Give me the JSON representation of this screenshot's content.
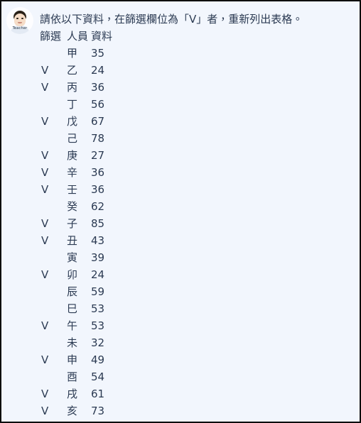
{
  "avatar": {
    "label": "Teacher",
    "icon": "user-avatar-icon"
  },
  "message": {
    "prompt": "請依以下資料，在篩選欄位為「V」者，重新列出表格。",
    "table": {
      "headers": {
        "filter": "篩選",
        "person": "人員",
        "data": "資料"
      },
      "rows": [
        {
          "filter": "",
          "person": "甲",
          "data": "35"
        },
        {
          "filter": "V",
          "person": "乙",
          "data": "24"
        },
        {
          "filter": "V",
          "person": "丙",
          "data": "36"
        },
        {
          "filter": "",
          "person": "丁",
          "data": "56"
        },
        {
          "filter": "V",
          "person": "戊",
          "data": "67"
        },
        {
          "filter": "",
          "person": "己",
          "data": "78"
        },
        {
          "filter": "V",
          "person": "庚",
          "data": "27"
        },
        {
          "filter": "V",
          "person": "辛",
          "data": "36"
        },
        {
          "filter": "V",
          "person": "壬",
          "data": "36"
        },
        {
          "filter": "",
          "person": "癸",
          "data": "62"
        },
        {
          "filter": "V",
          "person": "子",
          "data": "85"
        },
        {
          "filter": "V",
          "person": "丑",
          "data": "43"
        },
        {
          "filter": "",
          "person": "寅",
          "data": "39"
        },
        {
          "filter": "V",
          "person": "卯",
          "data": "24"
        },
        {
          "filter": "",
          "person": "辰",
          "data": "59"
        },
        {
          "filter": "",
          "person": "巳",
          "data": "53"
        },
        {
          "filter": "V",
          "person": "午",
          "data": "53"
        },
        {
          "filter": "",
          "person": "未",
          "data": "32"
        },
        {
          "filter": "V",
          "person": "申",
          "data": "49"
        },
        {
          "filter": "",
          "person": "酉",
          "data": "54"
        },
        {
          "filter": "V",
          "person": "戌",
          "data": "61"
        },
        {
          "filter": "V",
          "person": "亥",
          "data": "73"
        }
      ]
    }
  },
  "colors": {
    "background": "#f2f6fd",
    "text": "#2b3a52",
    "border": "#0d0d0d"
  }
}
